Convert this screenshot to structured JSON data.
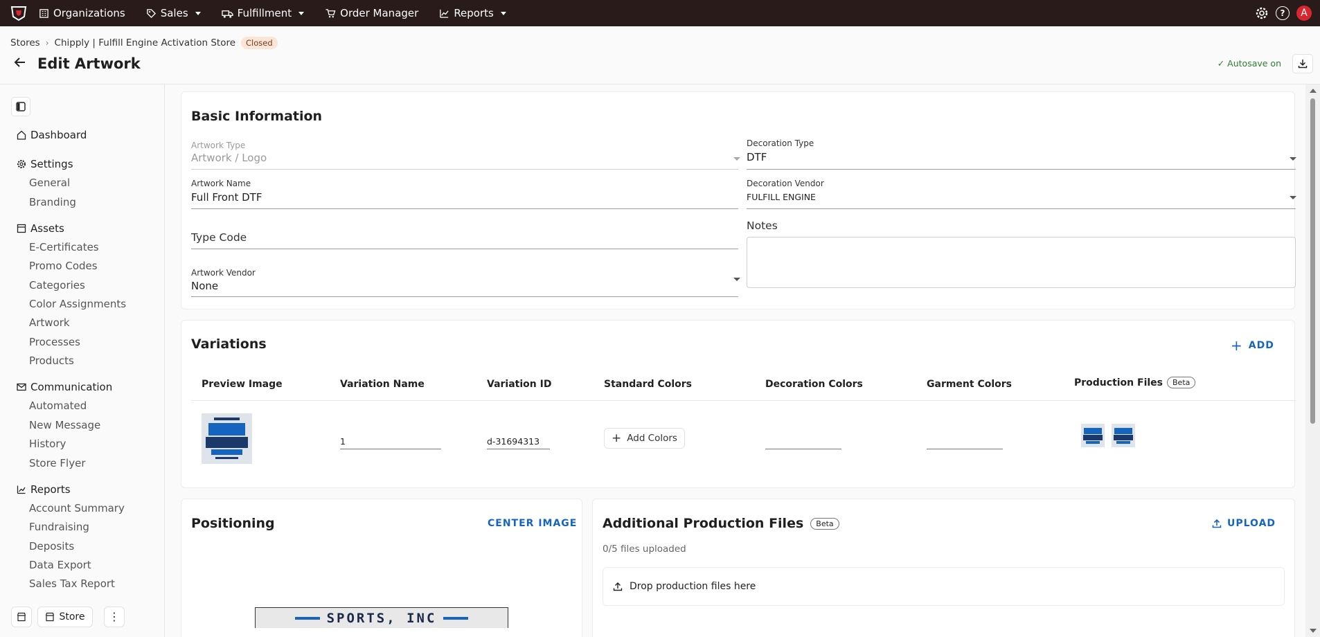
{
  "nav": {
    "items": [
      {
        "label": "Organizations",
        "icon": "building-icon",
        "dropdown": false
      },
      {
        "label": "Sales",
        "icon": "tag-icon",
        "dropdown": true
      },
      {
        "label": "Fulfillment",
        "icon": "truck-icon",
        "dropdown": true
      },
      {
        "label": "Order Manager",
        "icon": "cart-icon",
        "dropdown": false
      },
      {
        "label": "Reports",
        "icon": "chart-icon",
        "dropdown": true
      }
    ],
    "help_glyph": "?",
    "avatar_letter": "A",
    "accent": "#d7262e",
    "bg": "#2a1b1b"
  },
  "breadcrumb": {
    "items": [
      "Stores",
      "Chipply | Fulfill Engine Activation Store"
    ],
    "status": "Closed"
  },
  "page": {
    "title": "Edit Artwork",
    "autosave": "Autosave on"
  },
  "sidebar": {
    "sections": [
      {
        "label": "Dashboard",
        "icon": "home-icon",
        "items": []
      },
      {
        "label": "Settings",
        "icon": "gear-icon",
        "items": [
          "General",
          "Branding"
        ]
      },
      {
        "label": "Assets",
        "icon": "folder-icon",
        "items": [
          "E-Certificates",
          "Promo Codes",
          "Categories",
          "Color Assignments",
          "Artwork",
          "Processes",
          "Products"
        ]
      },
      {
        "label": "Communication",
        "icon": "mail-icon",
        "items": [
          "Automated",
          "New Message",
          "History",
          "Store Flyer"
        ]
      },
      {
        "label": "Reports",
        "icon": "chart-icon",
        "items": [
          "Account Summary",
          "Fundraising",
          "Deposits",
          "Data Export",
          "Sales Tax Report"
        ]
      }
    ],
    "store_button": "Store"
  },
  "basic_info": {
    "title": "Basic Information",
    "artwork_type": {
      "label": "Artwork Type",
      "value": "Artwork / Logo"
    },
    "decoration_type": {
      "label": "Decoration Type",
      "value": "DTF"
    },
    "artwork_name": {
      "label": "Artwork Name",
      "value": "Full Front DTF"
    },
    "decoration_vendor": {
      "label": "Decoration Vendor",
      "value": "FULFILL ENGINE"
    },
    "type_code": {
      "label": "Type Code",
      "value": ""
    },
    "notes": {
      "label": "Notes",
      "value": ""
    },
    "artwork_vendor": {
      "label": "Artwork Vendor",
      "value": "None"
    }
  },
  "variations": {
    "title": "Variations",
    "add_label": "ADD",
    "columns": [
      "Preview Image",
      "Variation Name",
      "Variation ID",
      "Standard Colors",
      "Decoration Colors",
      "Garment Colors",
      "Production Files"
    ],
    "beta": "Beta",
    "rows": [
      {
        "name": "1",
        "id": "d-31694313",
        "add_colors": "Add Colors"
      }
    ]
  },
  "positioning": {
    "title": "Positioning",
    "center_label": "CENTER IMAGE",
    "preview_text": "SPORTS, INC"
  },
  "additional_files": {
    "title": "Additional Production Files",
    "beta": "Beta",
    "upload_label": "UPLOAD",
    "count": "0/5 files uploaded",
    "drop_label": "Drop production files here"
  }
}
